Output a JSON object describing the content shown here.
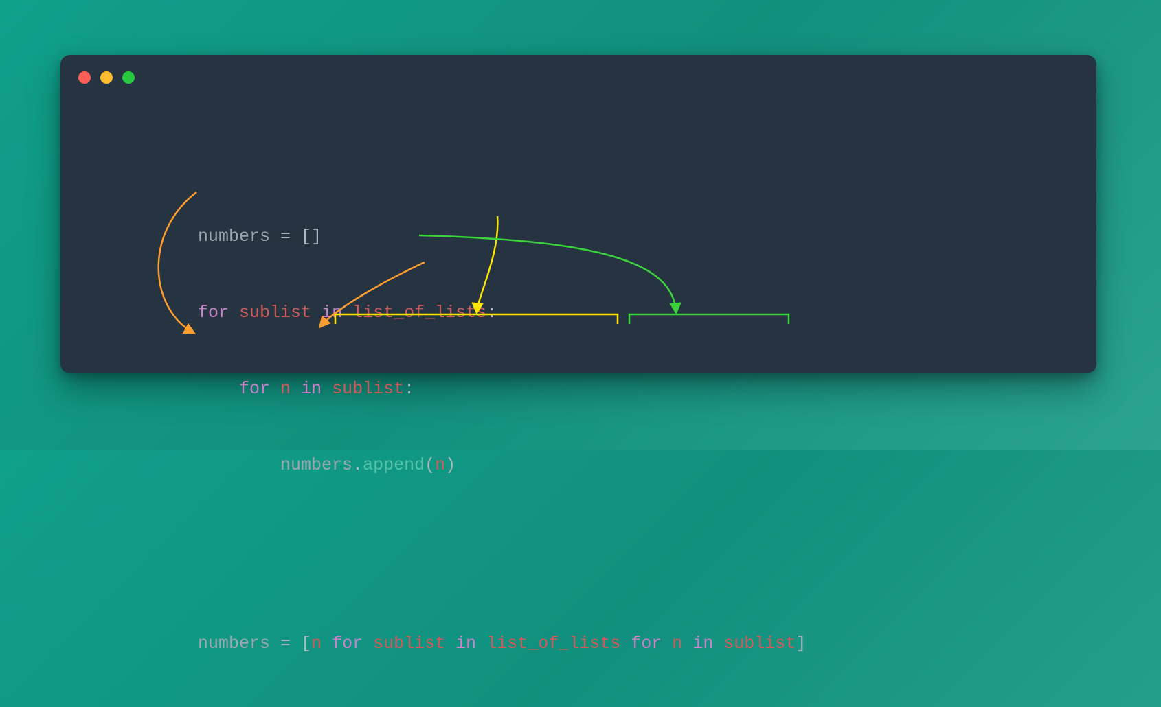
{
  "colors": {
    "bg_start": "#0fa08a",
    "bg_end": "#2aa391",
    "window": "#263341",
    "dot_red": "#ff5f57",
    "dot_yellow": "#febc2e",
    "dot_green": "#28c840",
    "arrow_orange": "#ff9d2e",
    "arrow_yellow": "#ffe600",
    "arrow_green": "#3bd23b",
    "token_name": "#9aa7b0",
    "token_kw": "#c981c9",
    "token_id": "#d05a5a",
    "token_call": "#56c3a8",
    "token_punc": "#b0b8bf"
  },
  "code": {
    "line1": {
      "t1": "numbers",
      "t2": " = ",
      "t3": "[]"
    },
    "line2": {
      "k1": "for",
      "sp1": " ",
      "v1": "sublist",
      "sp2": " ",
      "k2": "in",
      "sp3": " ",
      "v2": "list_of_lists",
      "p": ":"
    },
    "line3": {
      "indent": "    ",
      "k1": "for",
      "sp1": " ",
      "v1": "n",
      "sp2": " ",
      "k2": "in",
      "sp3": " ",
      "v2": "sublist",
      "p": ":"
    },
    "line4": {
      "indent": "        ",
      "obj": "numbers",
      "dot": ".",
      "fn": "append",
      "lp": "(",
      "arg": "n",
      "rp": ")"
    },
    "line5": {
      "t1": "numbers",
      "t2": " = ",
      "lb": "[",
      "arg": "n",
      "sp0": " ",
      "k1": "for",
      "sp1": " ",
      "v1": "sublist",
      "sp2": " ",
      "k2": "in",
      "sp3": " ",
      "v2": "list_of_lists",
      "sp4": " ",
      "k3": "for",
      "sp5": " ",
      "v3": "n",
      "sp6": " ",
      "k4": "in",
      "sp7": " ",
      "v4": "sublist",
      "rb": "]"
    }
  },
  "annotations": {
    "bracket_yellow": {
      "segment": "for sublist in list_of_lists",
      "source_line": 2,
      "target_line": 5
    },
    "bracket_green": {
      "segment": "for n in sublist",
      "source_line": 3,
      "target_line": 5
    },
    "arrow_orange_left": {
      "from": "numbers (line1)",
      "to": "numbers (line5)"
    },
    "arrow_orange_right": {
      "from": "n (line4 append arg)",
      "to": "n (line5 comprehension expr)"
    }
  }
}
